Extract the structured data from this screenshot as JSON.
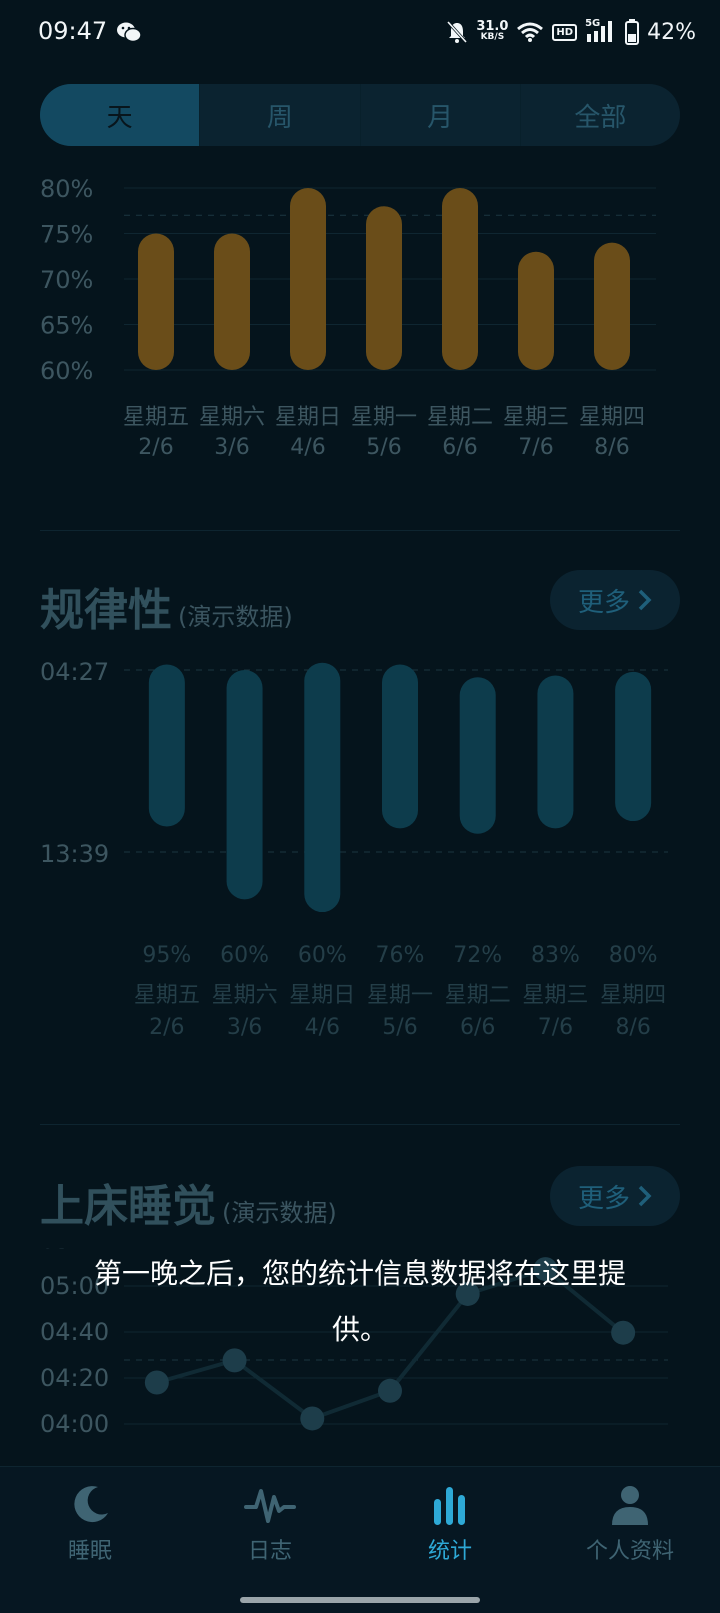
{
  "status": {
    "time": "09:47",
    "net_speed_value": "31.0",
    "net_speed_unit": "KB/S",
    "hd": "HD",
    "network": "5G",
    "battery": "42%"
  },
  "tabs": [
    "天",
    "周",
    "月",
    "全部"
  ],
  "colors": {
    "background": "#05141c",
    "bar_gold": "#6a4d19",
    "bar_teal": "#0d3c4c",
    "active_accent": "#2ea9d6"
  },
  "chart_data": [
    {
      "type": "bar",
      "title": "",
      "categories": [
        "星期五\n2/6",
        "星期六\n3/6",
        "星期日\n4/6",
        "星期一\n5/6",
        "星期二\n6/6",
        "星期三\n7/6",
        "星期四\n8/6"
      ],
      "category_days": [
        "星期五",
        "星期六",
        "星期日",
        "星期一",
        "星期二",
        "星期三",
        "星期四"
      ],
      "category_dates": [
        "2/6",
        "3/6",
        "4/6",
        "5/6",
        "6/6",
        "7/6",
        "8/6"
      ],
      "values": [
        75,
        75,
        80,
        78,
        80,
        73,
        74
      ],
      "yticks": [
        "80%",
        "75%",
        "70%",
        "65%",
        "60%"
      ],
      "ylim": [
        60,
        80
      ],
      "grid": true,
      "color": "#6a4d19"
    },
    {
      "type": "bar",
      "title": "规律性",
      "subtitle": "(演示数据)",
      "categories": [
        "星期五\n2/6",
        "星期六\n3/6",
        "星期日\n4/6",
        "星期一\n5/6",
        "星期二\n6/6",
        "星期三\n7/6",
        "星期四\n8/6"
      ],
      "yticks": [
        "04:27",
        "13:39"
      ],
      "range_top_fraction": [
        1.03,
        1.0,
        1.04,
        1.03,
        0.96,
        0.97,
        0.99
      ],
      "range_bottom_fraction": [
        0.14,
        -0.26,
        -0.33,
        0.13,
        0.1,
        0.13,
        0.17
      ],
      "percent_labels": [
        "95%",
        "60%",
        "60%",
        "76%",
        "72%",
        "83%",
        "80%"
      ],
      "color": "#0d3c4c"
    },
    {
      "type": "line",
      "title": "上床睡觉",
      "subtitle": "(演示数据)",
      "yticks": [
        "05:",
        "05:00",
        "04:40",
        "04:20",
        "04:00"
      ],
      "y_minutes_after_0400": [
        15,
        23,
        2,
        12,
        47,
        56,
        33
      ],
      "ylim_minutes": [
        0,
        60
      ],
      "grid": true,
      "color": "#1d3d4a"
    }
  ],
  "sections": {
    "regularity": {
      "title": "规律性",
      "subtitle": "(演示数据)",
      "more": "更多"
    },
    "bedtime": {
      "title": "上床睡觉",
      "subtitle": "(演示数据)",
      "more": "更多"
    }
  },
  "toast_text": "第一晚之后，您的统计信息数据将在这里提供。",
  "nav": [
    {
      "label": "睡眠",
      "icon": "moon-icon"
    },
    {
      "label": "日志",
      "icon": "wave-icon"
    },
    {
      "label": "统计",
      "icon": "bar-chart-icon"
    },
    {
      "label": "个人资料",
      "icon": "person-icon"
    }
  ]
}
